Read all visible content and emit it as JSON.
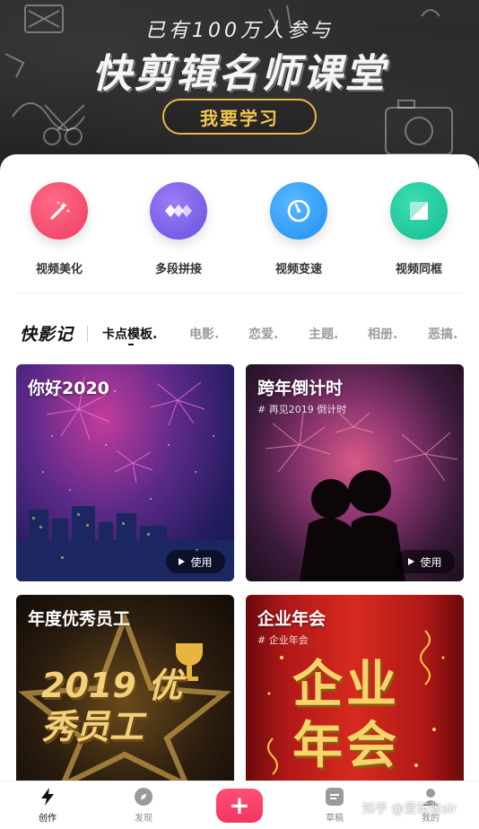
{
  "banner": {
    "subtitle": "已有100万人参与",
    "title": "快剪辑名师课堂",
    "cta": "我要学习"
  },
  "tools": [
    {
      "label": "视频美化",
      "icon": "magic-wand-icon",
      "color": "#f2486a"
    },
    {
      "label": "多段拼接",
      "icon": "segments-icon",
      "color": "#7c5ce8"
    },
    {
      "label": "视频变速",
      "icon": "speedometer-icon",
      "color": "#2f9ff2"
    },
    {
      "label": "视频同框",
      "icon": "split-frame-icon",
      "color": "#19c59e"
    }
  ],
  "categories": {
    "brand": "快影记",
    "items": [
      "卡点模板.",
      "电影.",
      "恋爱.",
      "主题.",
      "相册.",
      "恶搞."
    ],
    "active": "卡点模板."
  },
  "cards": [
    {
      "title": "你好2020",
      "tag": "",
      "action": "使用"
    },
    {
      "title": "跨年倒计时",
      "tag": "# 再见2019 倒计时",
      "action": "使用"
    },
    {
      "title": "年度优秀员工",
      "tag": "",
      "art": "2019 优秀员工"
    },
    {
      "title": "企业年会",
      "tag": "# 企业年会",
      "art": "企业 年会"
    }
  ],
  "nav": {
    "items": [
      "创作",
      "发现",
      "草稿",
      "我的"
    ],
    "active": "创作",
    "plus": "+"
  },
  "watermark": "知乎 @爱玩张sir",
  "colors": {
    "accent": "#f2365f",
    "banner_button": "#e8b845"
  }
}
